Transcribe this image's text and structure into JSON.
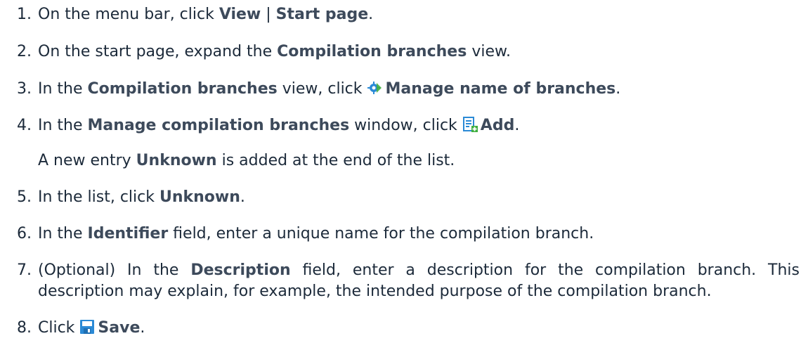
{
  "steps": [
    {
      "n": "1.",
      "t1": "On the menu bar, click ",
      "b1": "View",
      "t2": " | ",
      "b2": "Start page",
      "t3": "."
    },
    {
      "n": "2.",
      "t1": "On the start page, expand the ",
      "b1": "Compilation branches",
      "t2": " view."
    },
    {
      "n": "3.",
      "t1": "In the ",
      "b1": "Compilation branches",
      "t2": " view, click ",
      "b2": "Manage name of branches",
      "t3": "."
    },
    {
      "n": "4.",
      "t1": "In the ",
      "b1": "Manage compilation branches",
      "t2": " window, click ",
      "b2": "Add",
      "t3": "."
    },
    {
      "note": {
        "t1": "A new entry ",
        "b1": "Unknown",
        "t2": " is added at the end of the list."
      }
    },
    {
      "n": "5.",
      "t1": "In the list, click ",
      "b1": "Unknown",
      "t2": "."
    },
    {
      "n": "6.",
      "t1": "In the ",
      "b1": "Identifier",
      "t2": " field, enter a unique name for the compilation branch."
    },
    {
      "n": "7.",
      "t1": "(Optional) In the ",
      "b1": "Description",
      "t2": " field, enter a description for the compilation branch. This description may explain, for example, the intended purpose of the compilation branch."
    },
    {
      "n": "8.",
      "t1": "Click ",
      "b1": "Save",
      "t2": "."
    }
  ],
  "icons": {
    "manage": "gear-icon",
    "add": "add-document-icon",
    "save": "save-disk-icon"
  },
  "colors": {
    "text": "#1c2a3a",
    "bold": "#3d4a5b",
    "icon_blue": "#2b8ad6",
    "icon_green": "#3fae3f"
  }
}
